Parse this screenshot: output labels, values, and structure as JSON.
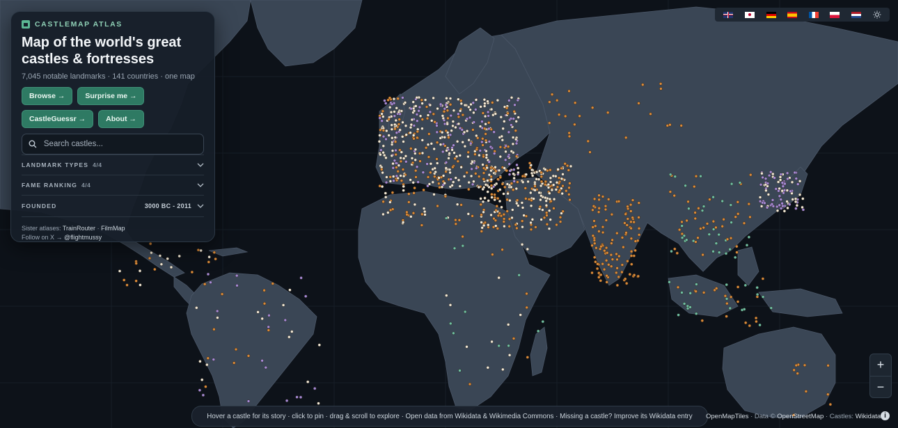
{
  "brand": "CASTLEMAP ATLAS",
  "title_line1": "Map of the world's great",
  "title_line2": "castles & fortresses",
  "subtitle": "7,045 notable landmarks · 141 countries · one map",
  "buttons": {
    "browse": "Browse →",
    "surprise": "Surprise me →",
    "guessr": "CastleGuessr →",
    "about": "About →"
  },
  "search": {
    "placeholder": "Search castles..."
  },
  "filters": {
    "types_label": "LANDMARK TYPES",
    "types_count": "4/4",
    "fame_label": "FAME RANKING",
    "fame_count": "4/4",
    "founded_label": "FOUNDED",
    "founded_range": "3000 BC - 2011"
  },
  "sister_prefix": "Sister atlases: ",
  "sister_1": "TrainRouter",
  "sister_sep": " · ",
  "sister_2": "FilmMap",
  "follow_prefix": "Follow on X → ",
  "follow_handle": "@flightmussy",
  "languages": [
    "gb-flag-icon",
    "jp-flag-icon",
    "de-flag-icon",
    "es-flag-icon",
    "fr-flag-icon",
    "pl-flag-icon",
    "nl-flag-icon",
    "sun-icon"
  ],
  "zoom": {
    "in": "+",
    "out": "−"
  },
  "hint": "Hover a castle for its story · click to pin · drag & scroll to explore  ·  Open data from Wikidata & Wikimedia Commons · Missing a castle? Improve its Wikidata entry",
  "attribution": {
    "tiles": "OpenMapTiles",
    "sep1": " · Data © ",
    "osm": "OpenStreetMap",
    "sep2": " · Castles: ",
    "wikidata": "Wikidata"
  },
  "info_icon": "i",
  "colors": {
    "ocean": "#0d1219",
    "land": "#3a4655",
    "accent": "#2e7a63",
    "dot_orange": "#d98a3a",
    "dot_cream": "#f1e8d6",
    "dot_purple": "#a58ad6",
    "dot_teal": "#6fbfa3"
  }
}
